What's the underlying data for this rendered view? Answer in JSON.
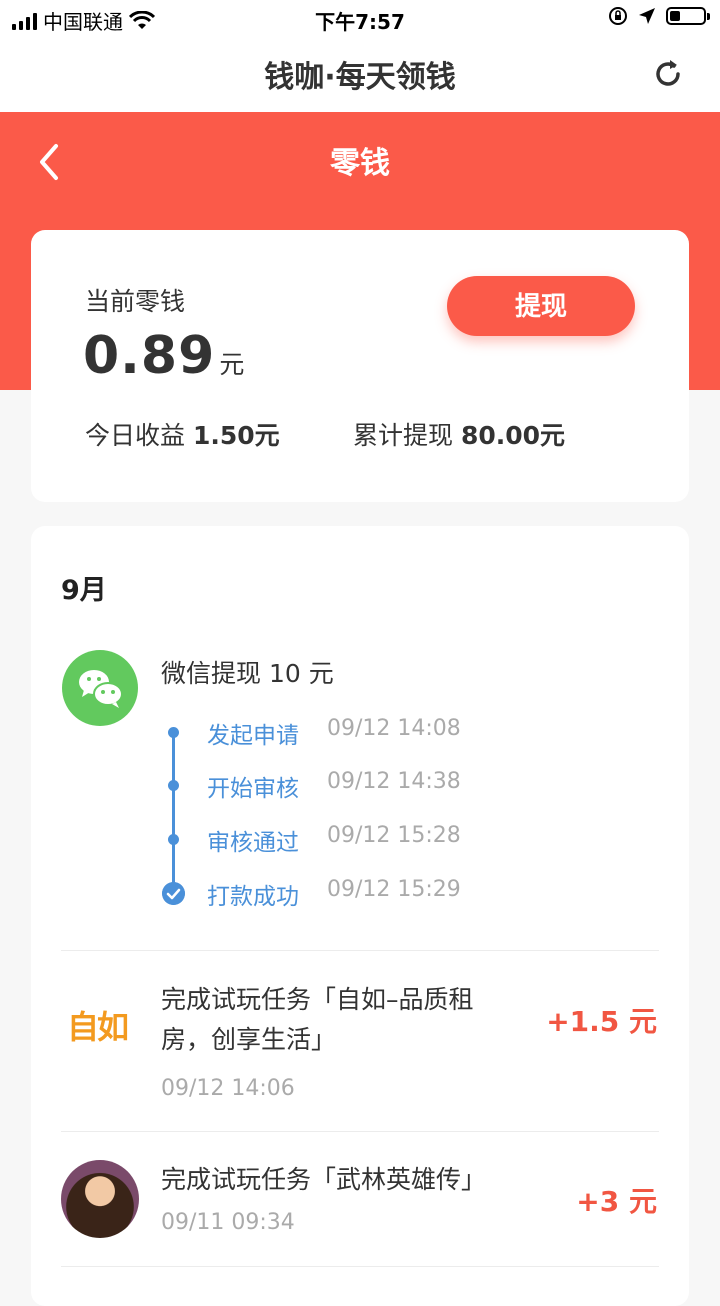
{
  "status_bar": {
    "carrier": "中国联通",
    "time": "下午7:57",
    "battery_level": 0.3
  },
  "app": {
    "title": "钱咖·每天领钱"
  },
  "header": {
    "title": "零钱"
  },
  "balance": {
    "label": "当前零钱",
    "value": "0.89",
    "unit": "元",
    "withdraw_label": "提现",
    "today_label": "今日收益",
    "today_value": "1.50元",
    "total_label": "累计提现",
    "total_value": "80.00元"
  },
  "records": {
    "month": "9月",
    "withdrawal": {
      "title": "微信提现 10 元",
      "steps": [
        {
          "label": "发起申请",
          "time": "09/12 14:08"
        },
        {
          "label": "开始审核",
          "time": "09/12 14:38"
        },
        {
          "label": "审核通过",
          "time": "09/12 15:28"
        },
        {
          "label": "打款成功",
          "time": "09/12 15:29"
        }
      ]
    },
    "tasks": [
      {
        "logo_text": "自如",
        "line1": "完成试玩任务「自如–品质租",
        "line2": "房，创享生活」",
        "date": "09/12 14:06",
        "reward": "+1.5 元"
      },
      {
        "line1": "完成试玩任务「武林英雄传」",
        "date": "09/11 09:34",
        "reward": "+3 元"
      }
    ]
  },
  "colors": {
    "accent": "#fb5a49",
    "timeline": "#4a90d9",
    "reward": "#f15642",
    "wechat": "#62c95e",
    "ziroom": "#f39a1f"
  }
}
